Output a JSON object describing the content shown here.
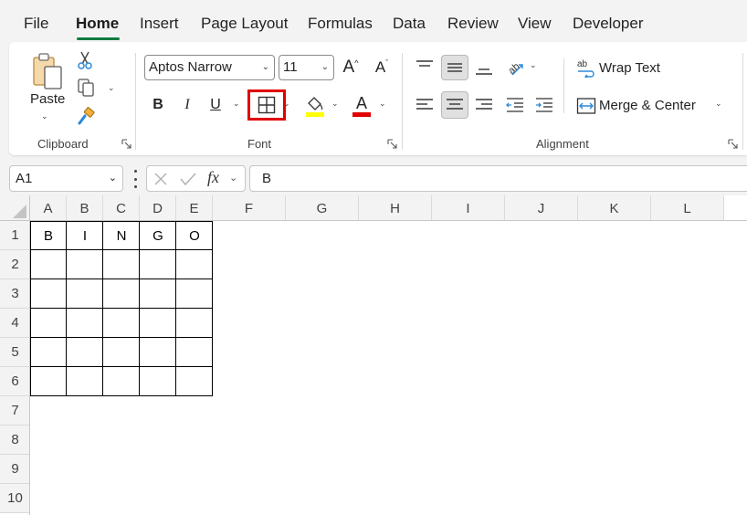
{
  "menu": {
    "items": [
      {
        "id": "file",
        "label": "File"
      },
      {
        "id": "home",
        "label": "Home",
        "active": true
      },
      {
        "id": "insert",
        "label": "Insert"
      },
      {
        "id": "page-layout",
        "label": "Page Layout"
      },
      {
        "id": "formulas",
        "label": "Formulas"
      },
      {
        "id": "data",
        "label": "Data"
      },
      {
        "id": "review",
        "label": "Review"
      },
      {
        "id": "view",
        "label": "View"
      },
      {
        "id": "developer",
        "label": "Developer"
      }
    ]
  },
  "ribbon": {
    "clipboard": {
      "label": "Clipboard",
      "paste_label": "Paste"
    },
    "font": {
      "label": "Font",
      "font_name": "Aptos Narrow",
      "font_size": "11",
      "bold_label": "B",
      "italic_label": "I",
      "underline_label": "U",
      "grow_label": "A",
      "shrink_label": "A",
      "font_color_label": "A",
      "fill_color": "#ffff00",
      "font_color": "#e00000",
      "borders_highlight_color": "#e00000"
    },
    "alignment": {
      "label": "Alignment",
      "wrap_text_label": "Wrap Text",
      "merge_center_label": "Merge & Center"
    }
  },
  "formula_bar": {
    "name_box": "A1",
    "fx_label": "fx",
    "content": "B"
  },
  "sheet": {
    "columns": [
      "A",
      "B",
      "C",
      "D",
      "E",
      "F",
      "G",
      "H",
      "I",
      "J",
      "K",
      "L"
    ],
    "rows": [
      "1",
      "2",
      "3",
      "4",
      "5",
      "6",
      "7",
      "8",
      "9",
      "10"
    ],
    "cells": {
      "A1": "B",
      "B1": "I",
      "C1": "N",
      "D1": "G",
      "E1": "O"
    }
  }
}
